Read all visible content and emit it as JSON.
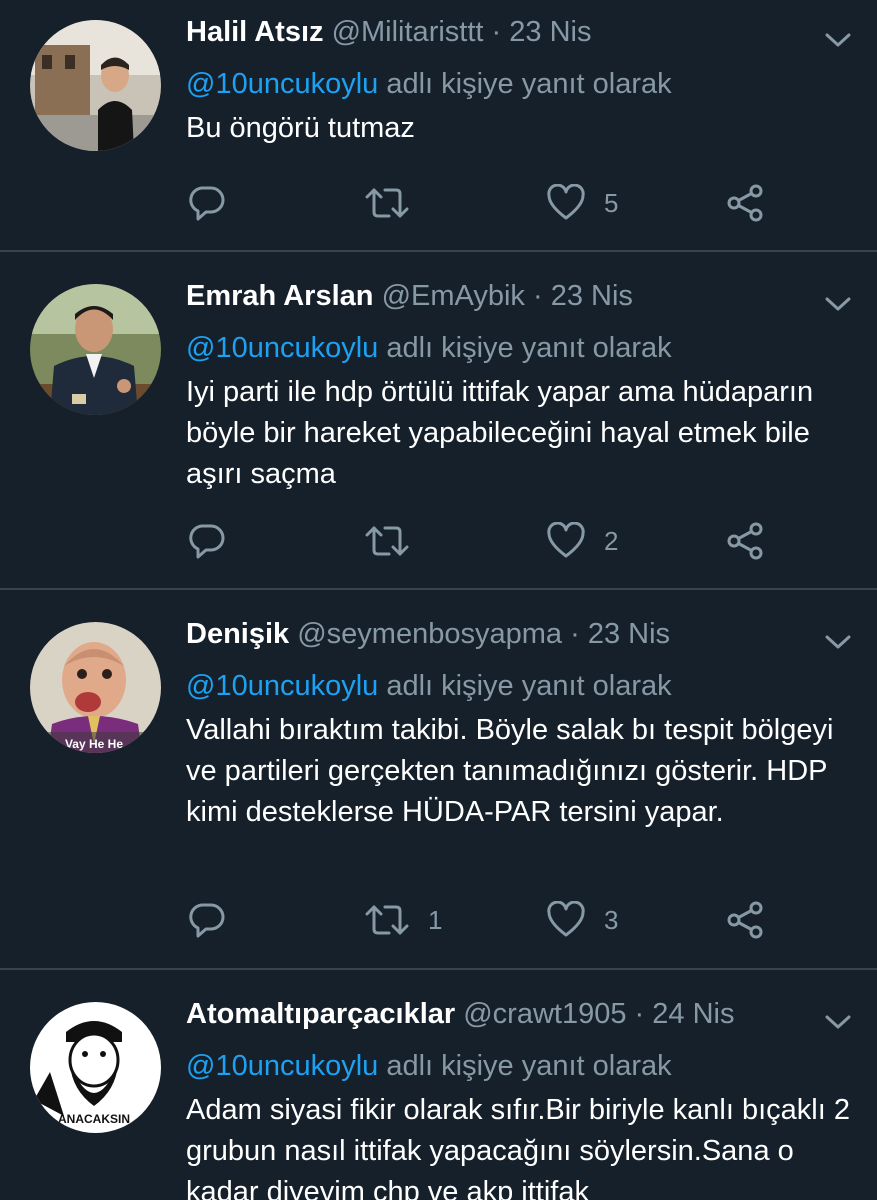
{
  "tweets": [
    {
      "name": "Halil Atsız",
      "handle": "@Militaristtt",
      "separator": "·",
      "date": "23 Nis",
      "reply_mention": "@10uncukoylu",
      "reply_suffix": "adlı kişiye yanıt olarak",
      "text": "Bu öngörü tutmaz",
      "retweets": "",
      "likes": "5"
    },
    {
      "name": "Emrah Arslan",
      "handle": "@EmAybik",
      "separator": "·",
      "date": "23 Nis",
      "reply_mention": "@10uncukoylu",
      "reply_suffix": "adlı kişiye yanıt olarak",
      "text": "Iyi parti ile hdp örtülü ittifak yapar ama hüdaparın böyle bir hareket yapabileceğini hayal etmek bile aşırı saçma",
      "retweets": "",
      "likes": "2"
    },
    {
      "name": "Denişik",
      "handle": "@seymenbosyapma",
      "separator": "·",
      "date": "23 Nis",
      "reply_mention": "@10uncukoylu",
      "reply_suffix": "adlı kişiye yanıt olarak",
      "text": "Vallahi bıraktım takibi. Böyle salak bı tespit bölgeyi ve partileri gerçekten tanımadığınızı gösterir. HDP kimi desteklerse HÜDA-PAR tersini yapar.",
      "retweets": "1",
      "likes": "3",
      "avatar_caption": "Vay He He"
    },
    {
      "name": "Atomaltıparçacıklar",
      "handle": "@crawt1905",
      "separator": "·",
      "date": "24 Nis",
      "reply_mention": "@10uncukoylu",
      "reply_suffix": "adlı kişiye yanıt olarak",
      "text": "Adam siyasi fikir olarak sıfır.Bir biriyle kanlı bıçaklı 2 grubun nasıl ittifak yapacağını söylersin.Sana o kadar diyeyim chp ve akp ittifak",
      "avatar_caption": "ANACAKSIN"
    }
  ],
  "icons": {
    "reply": "reply-icon",
    "retweet": "retweet-icon",
    "like": "heart-icon",
    "share": "share-icon",
    "more": "chevron-down-icon"
  },
  "colors": {
    "background": "#15202b",
    "divider": "#38444d",
    "secondary_text": "#8899a6",
    "mention": "#1da1f2",
    "primary_text": "#ffffff"
  }
}
